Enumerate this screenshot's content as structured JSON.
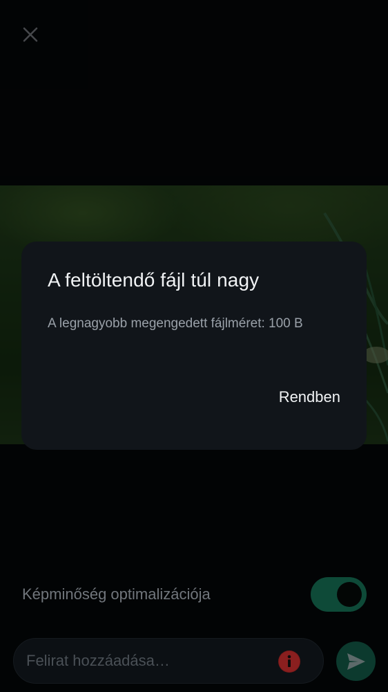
{
  "header": {
    "close_icon": "close-icon"
  },
  "dialog": {
    "title": "A feltöltendő fájl túl nagy",
    "message": "A legnagyobb megengedett fájlméret: 100 B",
    "ok_label": "Rendben"
  },
  "quality": {
    "label": "Képminőség optimalizációja",
    "enabled": true
  },
  "caption": {
    "placeholder": "Felirat hozzáadása…",
    "value": "",
    "info_icon": "info-icon"
  },
  "send": {
    "icon": "send-icon"
  },
  "colors": {
    "background": "#06090c",
    "dialog": "#11151a",
    "toggle_track": "#0e4a38",
    "info_icon": "#7a1a1a",
    "send_button": "#0c3a2e"
  }
}
